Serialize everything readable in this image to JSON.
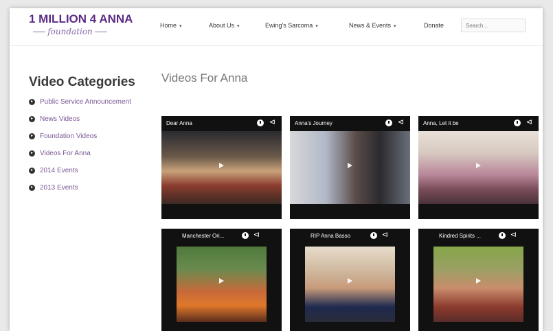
{
  "logo": {
    "line1": "1 MILLION 4 ANNA",
    "line2": "foundation"
  },
  "nav": [
    {
      "label": "Home",
      "has_menu": true
    },
    {
      "label": "About Us",
      "has_menu": true
    },
    {
      "label": "Ewing's Sarcoma",
      "has_menu": true
    },
    {
      "label": "News & Events",
      "has_menu": true
    },
    {
      "label": "Donate",
      "has_menu": false
    }
  ],
  "search": {
    "placeholder": "Search..."
  },
  "sidebar": {
    "title": "Video Categories",
    "items": [
      "Public Service Announcement",
      "News Videos",
      "Foundation Videos",
      "Videos For Anna",
      "2014 Events",
      "2013 Events"
    ]
  },
  "page_title": "Videos For Anna",
  "videos": [
    {
      "title": "Dear Anna"
    },
    {
      "title": "Anna's Journey"
    },
    {
      "title": "Anna, Let it be"
    },
    {
      "title": "Manchester Ori..."
    },
    {
      "title": "RIP Anna Basso"
    },
    {
      "title": "Kindred Spirits ..."
    }
  ],
  "icons": {
    "chevron": "chevron-down-icon",
    "bullet": "circle-arrow-icon",
    "clock": "watch-later-icon",
    "share": "share-icon",
    "play": "play-icon"
  },
  "colors": {
    "brand": "#5b2a86",
    "link": "#7a5896"
  }
}
